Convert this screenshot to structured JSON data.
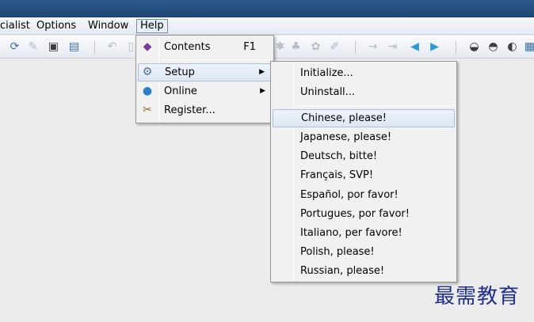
{
  "menubar": {
    "items": [
      {
        "label": "cialist"
      },
      {
        "label": "Options"
      },
      {
        "label": "Window"
      },
      {
        "label": "Help"
      }
    ]
  },
  "help_menu": {
    "items": [
      {
        "label": "Contents",
        "shortcut": "F1",
        "icon": "book-icon"
      },
      {
        "label": "Setup",
        "icon": "setup-icon",
        "submenu": true
      },
      {
        "label": "Online",
        "icon": "globe-icon",
        "submenu": true
      },
      {
        "label": "Register...",
        "icon": "tools-icon"
      }
    ]
  },
  "setup_menu": {
    "items": [
      {
        "label": "Initialize..."
      },
      {
        "label": "Uninstall..."
      },
      {
        "label": "Chinese, please!"
      },
      {
        "label": "Japanese, please!"
      },
      {
        "label": "Deutsch, bitte!"
      },
      {
        "label": "Français, SVP!"
      },
      {
        "label": "Español, por favor!"
      },
      {
        "label": "Portugues, por favor!"
      },
      {
        "label": "Italiano, per favore!"
      },
      {
        "label": "Polish, please!"
      },
      {
        "label": "Russian, please!"
      }
    ],
    "highlighted": "Chinese, please!"
  },
  "watermark": {
    "text": "最需教育"
  },
  "colors": {
    "titlebar": "#1e4674",
    "highlight_border": "#a8c3e3",
    "watermark": "#1f2f8f"
  }
}
